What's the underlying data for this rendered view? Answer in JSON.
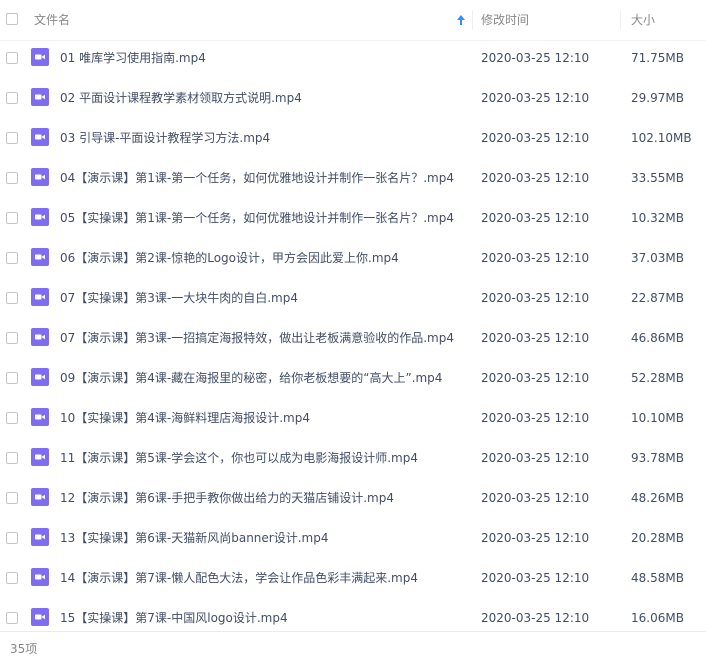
{
  "header": {
    "name_label": "文件名",
    "time_label": "修改时间",
    "size_label": "大小",
    "sort_icon": "arrow-up-icon"
  },
  "file_icon": "video-file-icon",
  "colors": {
    "icon": "#7f6cf0",
    "text": "#424e67",
    "header_text": "#888888"
  },
  "files": [
    {
      "name": "01 唯库学习使用指南.mp4",
      "time": "2020-03-25 12:10",
      "size": "71.75MB"
    },
    {
      "name": "02 平面设计课程教学素材领取方式说明.mp4",
      "time": "2020-03-25 12:10",
      "size": "29.97MB"
    },
    {
      "name": "03 引导课-平面设计教程学习方法.mp4",
      "time": "2020-03-25 12:10",
      "size": "102.10MB"
    },
    {
      "name": "04【演示课】第1课-第一个任务，如何优雅地设计并制作一张名片？.mp4",
      "time": "2020-03-25 12:10",
      "size": "33.55MB"
    },
    {
      "name": "05【实操课】第1课-第一个任务，如何优雅地设计并制作一张名片？.mp4",
      "time": "2020-03-25 12:10",
      "size": "10.32MB"
    },
    {
      "name": "06【演示课】第2课-惊艳的Logo设计，甲方会因此爱上你.mp4",
      "time": "2020-03-25 12:10",
      "size": "37.03MB"
    },
    {
      "name": "07【实操课】第3课-一大块牛肉的自白.mp4",
      "time": "2020-03-25 12:10",
      "size": "22.87MB"
    },
    {
      "name": "07【演示课】第3课-一招搞定海报特效，做出让老板满意验收的作品.mp4",
      "time": "2020-03-25 12:10",
      "size": "46.86MB"
    },
    {
      "name": "09【演示课】第4课-藏在海报里的秘密，给你老板想要的“高大上”.mp4",
      "time": "2020-03-25 12:10",
      "size": "52.28MB"
    },
    {
      "name": "10【实操课】第4课-海鲜料理店海报设计.mp4",
      "time": "2020-03-25 12:10",
      "size": "10.10MB"
    },
    {
      "name": "11【演示课】第5课-学会这个，你也可以成为电影海报设计师.mp4",
      "time": "2020-03-25 12:10",
      "size": "93.78MB"
    },
    {
      "name": "12【演示课】第6课-手把手教你做出给力的天猫店铺设计.mp4",
      "time": "2020-03-25 12:10",
      "size": "48.26MB"
    },
    {
      "name": "13【实操课】第6课-天猫新风尚banner设计.mp4",
      "time": "2020-03-25 12:10",
      "size": "20.28MB"
    },
    {
      "name": "14【演示课】第7课-懒人配色大法，学会让作品色彩丰满起来.mp4",
      "time": "2020-03-25 12:10",
      "size": "48.58MB"
    },
    {
      "name": "15【实操课】第7课-中国风logo设计.mp4",
      "time": "2020-03-25 12:10",
      "size": "16.06MB"
    }
  ],
  "footer": {
    "count": "35项"
  }
}
